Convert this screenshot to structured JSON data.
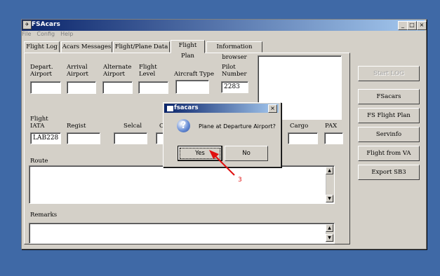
{
  "window": {
    "title": "FSAcars",
    "min": "_",
    "max": "□",
    "close": "×"
  },
  "menu": [
    "File",
    "Config",
    "Help"
  ],
  "tabs": [
    "Flight Log",
    "Acars Messages",
    "Flight/Plane Data",
    "Flight Plan",
    "Information browser"
  ],
  "form": {
    "depart_label_1": "Depart.",
    "depart_label_2": "Airport",
    "arrival_label_1": "Arrival",
    "arrival_label_2": "Airport",
    "alternate_label_1": "Alternate",
    "alternate_label_2": "Airport",
    "flight_level_label_1": "Flight",
    "flight_level_label_2": "Level",
    "aircraft_type_label": "Aircraft Type",
    "pilot_number_label_1": "Pilot",
    "pilot_number_label_2": "Number",
    "pilot_number_value": "2283",
    "flight_iata_label_1": "Flight",
    "flight_iata_label_2": "IATA",
    "flight_iata_value": "LAB228",
    "regist_label": "Regist",
    "selcal_label": "Selcal",
    "ca_label": "Ca",
    "cargo_label": "Cargo",
    "pax_label": "PAX",
    "route_label": "Route",
    "remarks_label": "Remarks"
  },
  "side_buttons": [
    "Start LOG",
    "FSacars",
    "FS Flight Plan",
    "Servinfo",
    "Flight from VA",
    "Export SB3"
  ],
  "dialog": {
    "title": "fsacars",
    "close": "×",
    "icon": "?",
    "message": "Plane at Departure Airport?",
    "yes_label": "Yes",
    "no_label": "No"
  },
  "annotation": {
    "label": "3",
    "color": "#e01010"
  }
}
